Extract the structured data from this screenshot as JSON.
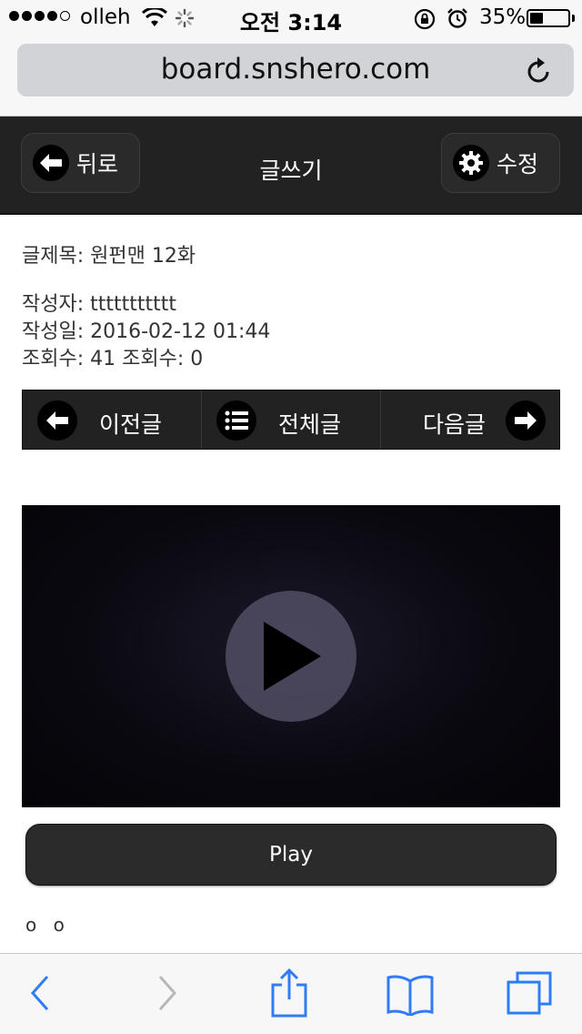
{
  "status_bar": {
    "carrier": "olleh",
    "time": "오전 3:14",
    "battery_percent": "35%",
    "battery_level": 0.35,
    "icons": [
      "signal-dots-icon",
      "wifi-icon",
      "activity-spinner-icon",
      "rotation-lock-icon",
      "alarm-icon",
      "battery-icon"
    ]
  },
  "address_bar": {
    "url": "board.snshero.com",
    "icon": "reload-icon"
  },
  "header": {
    "back_label": "뒤로",
    "title": "글쓰기",
    "edit_label": "수정",
    "icons": [
      "arrow-left-icon",
      "gear-icon"
    ]
  },
  "post": {
    "title_line": "글제목: 원펀맨 12화",
    "author_line": "작성자: ttttttttttt",
    "date_line": "작성일: 2016-02-12 01:44",
    "views_line": "조회수: 41 조회수: 0"
  },
  "post_nav": {
    "prev_label": "이전글",
    "list_label": "전체글",
    "next_label": "다음글",
    "icons": [
      "arrow-left-icon",
      "list-icon",
      "arrow-right-icon"
    ]
  },
  "video": {
    "icon": "play-icon"
  },
  "play_button": {
    "label": "Play"
  },
  "footer_text": "o o",
  "toolbar": {
    "icons": [
      "back-chevron-icon",
      "forward-chevron-icon",
      "share-icon",
      "bookmarks-icon",
      "tabs-icon"
    ],
    "accent_color": "#2f7cf6"
  },
  "colors": {
    "dark_bar": "#222222",
    "ios_blue": "#2f7cf6"
  }
}
